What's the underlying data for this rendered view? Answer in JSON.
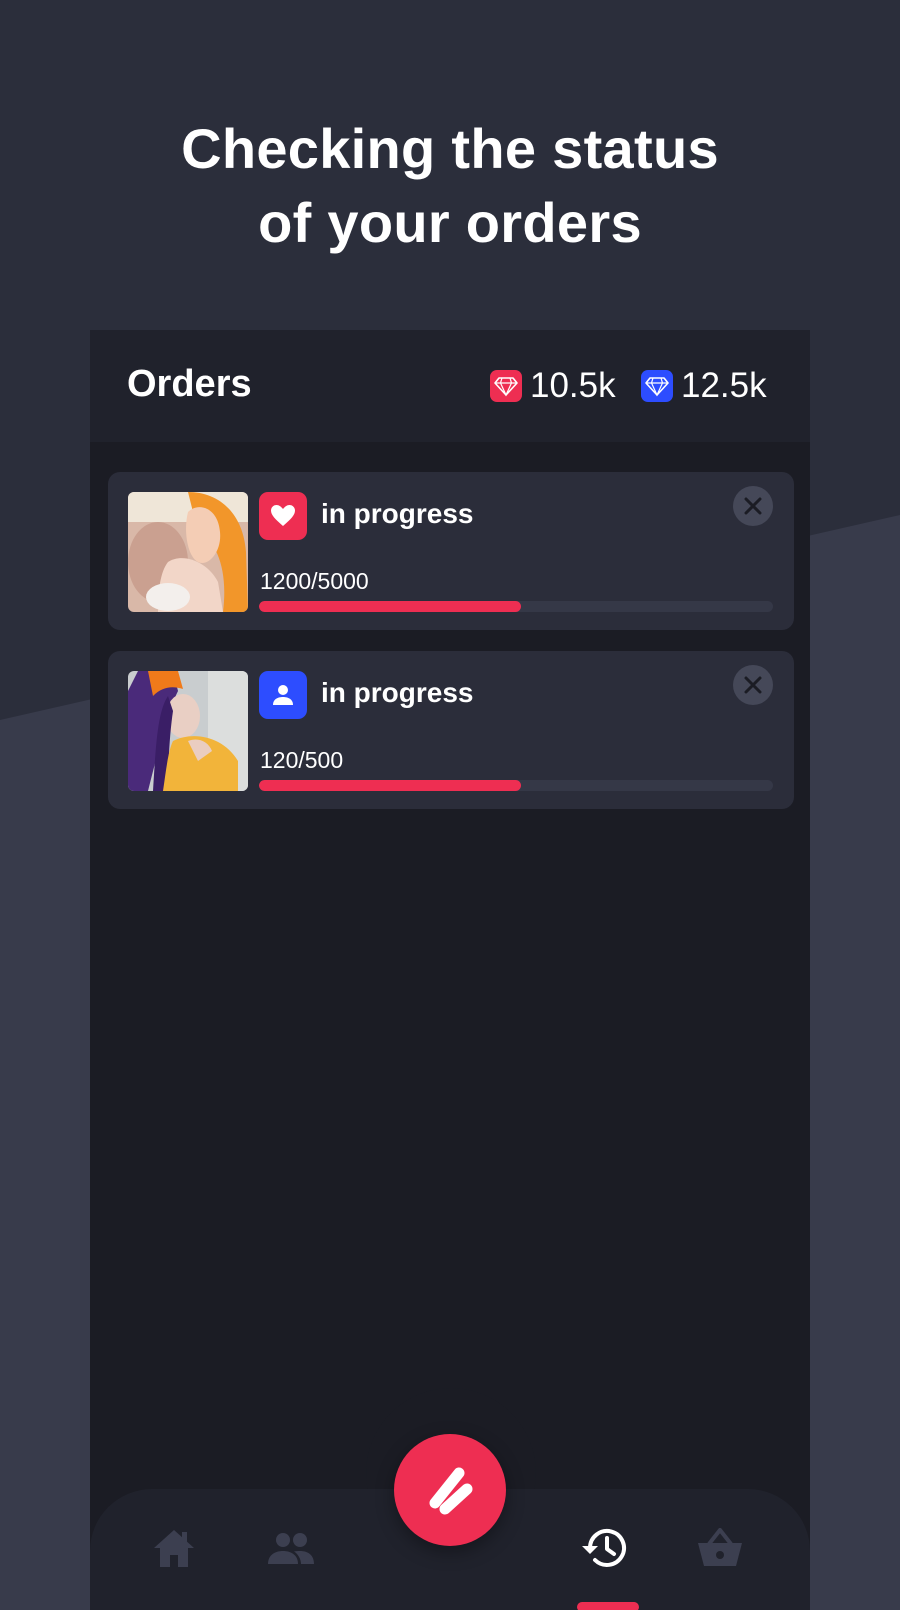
{
  "headline": {
    "line1": "Checking the status",
    "line2": "of your orders"
  },
  "orders_header": {
    "title": "Orders",
    "balances": [
      {
        "icon": "ruby-gem-icon",
        "color": "#ee2e52",
        "value": "10.5k"
      },
      {
        "icon": "blue-gem-icon",
        "color": "#2d4dff",
        "value": "12.5k"
      }
    ]
  },
  "orders": [
    {
      "thumbnail": "woman-orange-hair-photo",
      "type_icon": "heart-icon",
      "type_color": "#ee2e52",
      "status": "in progress",
      "count": "1200/5000",
      "progress": 0.51
    },
    {
      "thumbnail": "woman-purple-hair-photo",
      "type_icon": "user-icon",
      "type_color": "#2d4dff",
      "status": "in progress",
      "count": "120/500",
      "progress": 0.51
    }
  ],
  "tab_bar": {
    "tabs": [
      {
        "name": "home",
        "icon": "home-icon",
        "active": false
      },
      {
        "name": "friends",
        "icon": "people-icon",
        "active": false
      },
      {
        "name": "history",
        "icon": "history-icon",
        "active": true
      },
      {
        "name": "shop",
        "icon": "basket-icon",
        "active": false
      }
    ],
    "center_button_icon": "app-logo-icon"
  },
  "colors": {
    "accent": "#ee2e52",
    "blue": "#2d4dff",
    "background": "#2b2e3b",
    "panel": "#1b1c24"
  }
}
